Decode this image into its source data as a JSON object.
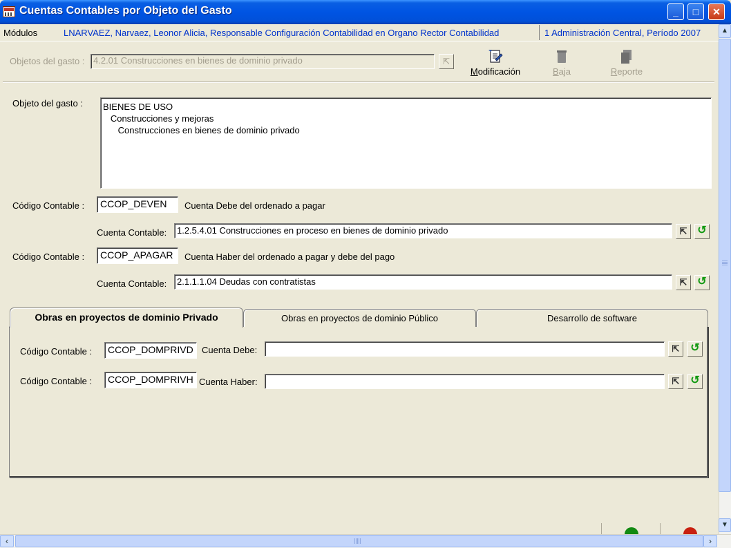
{
  "window": {
    "title": "Cuentas Contables por Objeto del Gasto",
    "minimize": "_",
    "maximize": "□",
    "close": "✕"
  },
  "status": {
    "modules": "Módulos",
    "user": "LNARVAEZ, Narvaez, Leonor Alicia, Responsable Configuración Contabilidad en Organo Rector Contabilidad",
    "period": "1 Administración Central, Período 2007"
  },
  "toolbar": {
    "search_label": "Objetos del gasto :",
    "search_value": "4.2.01 Construcciones en bienes de dominio privado",
    "modificacion": "Modificación",
    "baja": "Baja",
    "reporte": "Reporte"
  },
  "form": {
    "objeto_label": "Objeto del gasto :",
    "objeto_text": "BIENES DE USO\n   Construcciones y mejoras\n      Construcciones en bienes de dominio privado",
    "codigo_label": "Código Contable :",
    "cuenta_contable_label": "Cuenta Contable:",
    "debe": {
      "code": "CCOP_DEVEN",
      "description": "Cuenta Debe del ordenado a pagar",
      "cuenta": "1.2.5.4.01 Construcciones en proceso en bienes de dominio privado"
    },
    "haber": {
      "code": "CCOP_APAGAR",
      "description": "Cuenta Haber del ordenado a pagar y debe del pago",
      "cuenta": "2.1.1.1.04 Deudas con contratistas"
    }
  },
  "tabs": [
    {
      "label": "Obras en proyectos de dominio Privado",
      "active": true
    },
    {
      "label": "Obras en proyectos de dominio Público",
      "active": false
    },
    {
      "label": "Desarrollo de software",
      "active": false
    }
  ],
  "tab_content": {
    "codigo_label": "Código Contable :",
    "debe_code": "CCOP_DOMPRIVD",
    "debe_label": "Cuenta Debe:",
    "debe_value": "",
    "haber_code": "CCOP_DOMPRIVH",
    "haber_label": "Cuenta Haber:",
    "haber_value": ""
  },
  "icons": {
    "pick": "pick-from-list-icon",
    "undo": "undo-icon"
  },
  "colors": {
    "titlebar": "#0054e3",
    "status_link": "#0033cc",
    "window_bg": "#ece9d8",
    "undo_green": "#119911"
  }
}
